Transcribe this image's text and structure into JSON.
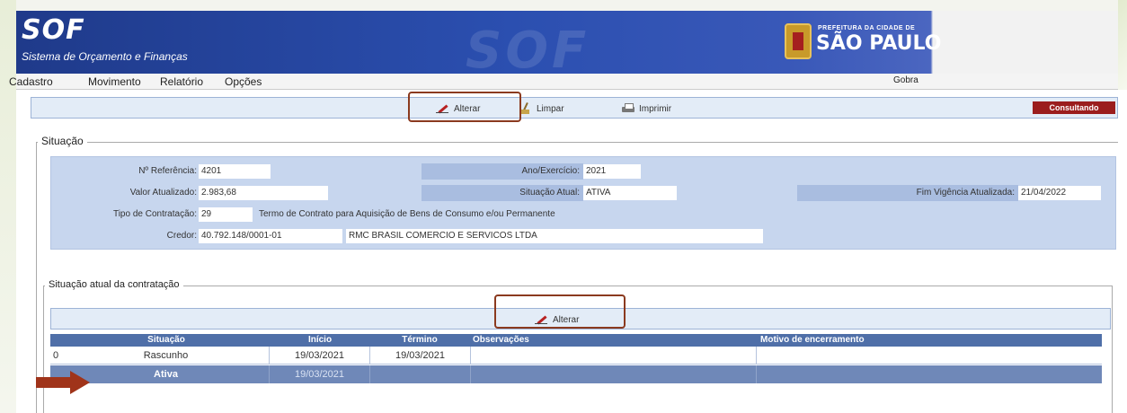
{
  "app": {
    "logo": "SOF",
    "subtitle": "Sistema de Orçamento e Finanças",
    "watermark": "SOF",
    "prefeitura_small": "PREFEITURA DA CIDADE DE",
    "prefeitura_big": "SÃO PAULO"
  },
  "menu": {
    "items": [
      "Cadastro",
      "Movimento",
      "Relatório",
      "Opções"
    ],
    "user": "Gobra"
  },
  "toolbar": {
    "alterar": "Alterar",
    "limpar": "Limpar",
    "imprimir": "Imprimir",
    "mode_badge": "Consultando"
  },
  "situacao": {
    "legend": "Situação",
    "nr_referencia_label": "Nº Referência:",
    "nr_referencia": "4201",
    "ano_exercicio_label": "Ano/Exercício:",
    "ano_exercicio": "2021",
    "valor_atualizado_label": "Valor Atualizado:",
    "valor_atualizado": "2.983,68",
    "situacao_atual_label": "Situação Atual:",
    "situacao_atual": "ATIVA",
    "fim_vigencia_label": "Fim Vigência Atualizada:",
    "fim_vigencia": "21/04/2022",
    "tipo_contratacao_label": "Tipo de Contratação:",
    "tipo_contratacao_codigo": "29",
    "tipo_contratacao_desc": "Termo de Contrato para Aquisição de Bens de Consumo e/ou Permanente",
    "credor_label": "Credor:",
    "credor_cnpj": "40.792.148/0001-01",
    "credor_nome": "RMC BRASIL COMERCIO E SERVICOS LTDA"
  },
  "contratacao": {
    "legend": "Situação atual da contratação",
    "alterar": "Alterar",
    "columns": [
      "Situação",
      "Início",
      "Término",
      "Observações",
      "Motivo de encerramento"
    ],
    "rows": [
      {
        "idx": "0",
        "situacao": "Rascunho",
        "inicio": "19/03/2021",
        "termino": "19/03/2021",
        "observacoes": "",
        "motivo": ""
      },
      {
        "idx": "",
        "situacao": "Ativa",
        "inicio": "19/03/2021",
        "termino": "",
        "observacoes": "",
        "motivo": ""
      }
    ]
  },
  "colors": {
    "header_blue": "#2b4fb0",
    "toolbar_bg": "#e3ecf7",
    "panel_bg": "#c7d6ee",
    "grid_header": "#4f6fa8",
    "selected_row": "#6f88b8",
    "badge_red": "#9b1d1d",
    "highlight_border": "#8b3a1f"
  }
}
